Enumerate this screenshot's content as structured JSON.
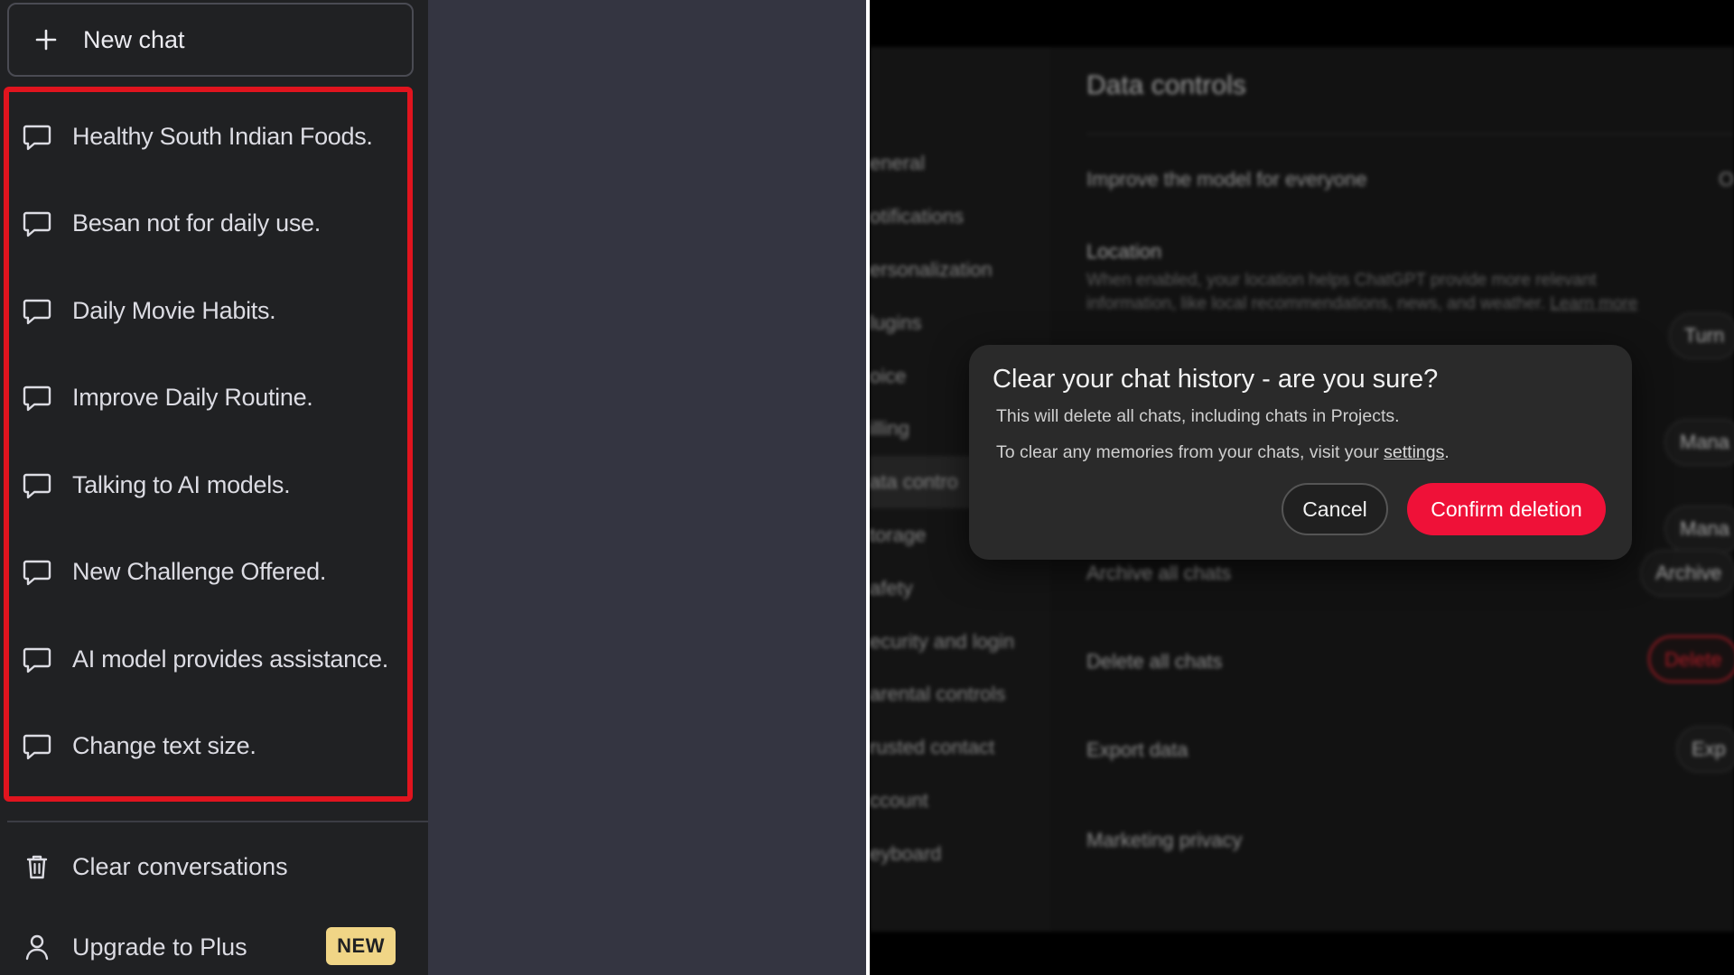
{
  "sidebar": {
    "new_chat_label": "New chat",
    "chats": [
      {
        "label": "Healthy South Indian Foods."
      },
      {
        "label": "Besan not for daily use."
      },
      {
        "label": "Daily Movie Habits."
      },
      {
        "label": "Improve Daily Routine."
      },
      {
        "label": "Talking to AI models."
      },
      {
        "label": "New Challenge Offered."
      },
      {
        "label": "AI model provides assistance."
      },
      {
        "label": "Change text size."
      }
    ],
    "clear_label": "Clear conversations",
    "upgrade_label": "Upgrade to Plus",
    "upgrade_badge": "NEW"
  },
  "settings": {
    "title": "Data controls",
    "nav": [
      "eneral",
      "otifications",
      "ersonalization",
      "lugins",
      "oice",
      "illing",
      "ata contro",
      "torage",
      "afety",
      "ecurity and login",
      "arental controls",
      "rusted contact",
      "ccount",
      "eyboard"
    ],
    "rows": {
      "improve": "Improve the model for everyone",
      "improve_value": "O",
      "location": "Location",
      "location_desc": "When enabled, your location helps ChatGPT provide more relevant information, like local recommendations, news, and weather.",
      "location_link": "Learn more",
      "location_btn": "Turn",
      "manage_btn_1": "Mana",
      "manage_btn_2": "Mana",
      "archive": "Archive all chats",
      "archive_btn": "Archive",
      "delete": "Delete all chats",
      "delete_btn": "Delete",
      "export": "Export data",
      "export_btn": "Exp",
      "marketing": "Marketing privacy"
    }
  },
  "dialog": {
    "title": "Clear your chat history - are you sure?",
    "body1": "This will delete all chats, including chats in Projects.",
    "body2_prefix": "To clear any memories from your chats, visit your ",
    "body2_link": "settings",
    "body2_suffix": ".",
    "cancel_label": "Cancel",
    "confirm_label": "Confirm deletion"
  },
  "colors": {
    "highlight": "#e0141e",
    "confirm": "#ef1138",
    "badge": "#f0d586"
  },
  "icons": {
    "chat": "chat-bubble-icon",
    "plus": "plus-icon",
    "trash": "trash-icon",
    "user": "user-icon"
  }
}
